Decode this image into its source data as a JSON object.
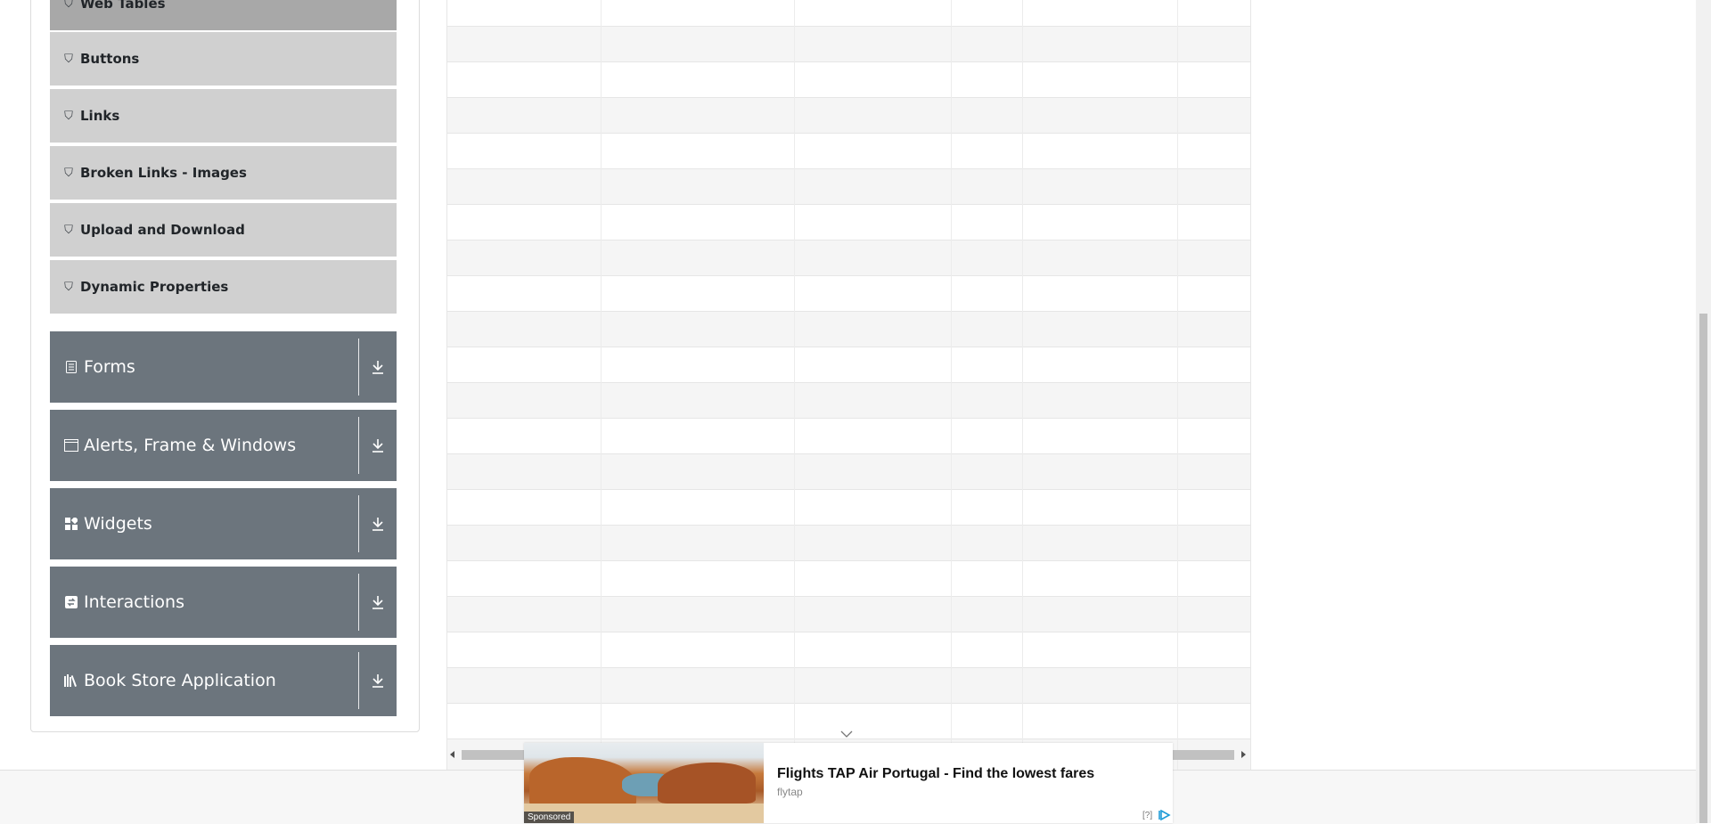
{
  "sidebar": {
    "subitems": [
      {
        "label": "Web Tables",
        "icon": "html5-icon"
      },
      {
        "label": "Buttons",
        "icon": "html5-icon"
      },
      {
        "label": "Links",
        "icon": "html5-icon"
      },
      {
        "label": "Broken Links - Images",
        "icon": "html5-icon"
      },
      {
        "label": "Upload and Download",
        "icon": "html5-icon"
      },
      {
        "label": "Dynamic Properties",
        "icon": "html5-icon"
      }
    ],
    "groups": [
      {
        "label": "Forms",
        "icon": "form-icon"
      },
      {
        "label": "Alerts, Frame & Windows",
        "icon": "window-icon"
      },
      {
        "label": "Widgets",
        "icon": "widgets-icon"
      },
      {
        "label": "Interactions",
        "icon": "interactions-icon"
      },
      {
        "label": "Book Store Application",
        "icon": "books-icon"
      }
    ]
  },
  "ad": {
    "title": "Flights TAP Air Portugal - Find the lowest fares",
    "source": "flytap",
    "sponsored": "Sponsored",
    "help": "[?]"
  },
  "colors": {
    "group_bg": "#6c757d",
    "subitem_bg": "#d0d0d0",
    "subitem_active_bg": "#a8a8a8",
    "ad_choices": "#1e9bd7"
  }
}
